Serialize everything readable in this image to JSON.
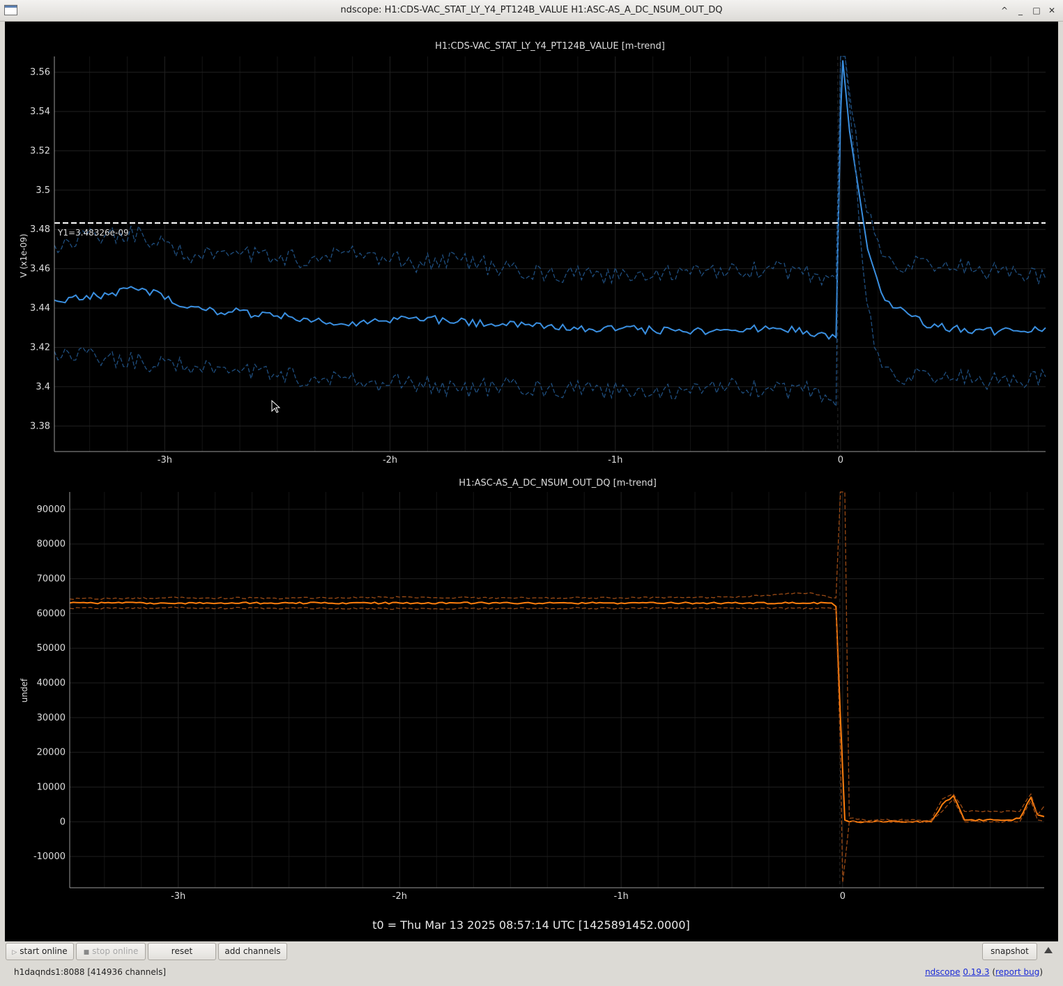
{
  "window": {
    "title": "ndscope: H1:CDS-VAC_STAT_LY_Y4_PT124B_VALUE H1:ASC-AS_A_DC_NSUM_OUT_DQ",
    "controls": [
      "^",
      "_",
      "□",
      "✕"
    ]
  },
  "toolbar": {
    "start_online": "start online",
    "stop_online": "stop online",
    "reset": "reset",
    "add_channels": "add channels",
    "snapshot": "snapshot"
  },
  "status": {
    "server": "h1daqnds1:8088  [414936 channels]",
    "ndscope_link": "ndscope",
    "version_link": "0.19.3",
    "report_bug_link": "report bug"
  },
  "t0_label": "t0 = Thu Mar 13 2025 08:57:14 UTC [1425891452.0000]",
  "colors": {
    "plot_bg": "#000000",
    "grid": "#1f1f1f",
    "text": "#dddddd",
    "series_top": "#3a8fe0",
    "series_top_minmax": "#1f4f80",
    "series_bottom": "#ff7f0e",
    "series_bottom_minmax": "#9a4a15",
    "cursor": "#ffffff"
  },
  "chart_data": [
    {
      "type": "line",
      "title": "H1:CDS-VAC_STAT_LY_Y4_PT124B_VALUE [m-trend]",
      "xlabel": "",
      "ylabel": "V (x1e-09)",
      "x_unit": "hours relative to t0",
      "xlim": [
        -3.49,
        0.91
      ],
      "ylim": [
        3.367,
        3.568
      ],
      "x_tick_values": [
        -3,
        -2,
        -1,
        0
      ],
      "x_tick_labels": [
        "-3h",
        "-2h",
        "-1h",
        "0"
      ],
      "y_ticks": [
        3.38,
        3.4,
        3.42,
        3.44,
        3.46,
        3.48,
        3.5,
        3.52,
        3.54,
        3.56
      ],
      "y_tick_labels": [
        "3.38",
        "3.4",
        "3.42",
        "3.44",
        "3.46",
        "3.48",
        "3.5",
        "3.52",
        "3.54",
        "3.56"
      ],
      "grid": true,
      "cursor": {
        "value": 3.48326,
        "label": "Y1=3.48326e-09"
      },
      "series": [
        {
          "role": "mean",
          "style": "solid",
          "x": [
            -3.49,
            -3.3,
            -3.1,
            -2.9,
            -2.7,
            -2.5,
            -2.3,
            -2.1,
            -1.9,
            -1.7,
            -1.5,
            -1.3,
            -1.1,
            -0.9,
            -0.7,
            -0.5,
            -0.3,
            -0.1,
            -0.02,
            0.0,
            0.01,
            0.04,
            0.08,
            0.12,
            0.18,
            0.25,
            0.3,
            0.4,
            0.5,
            0.6,
            0.7,
            0.8,
            0.91
          ],
          "y": [
            3.444,
            3.446,
            3.45,
            3.44,
            3.438,
            3.436,
            3.433,
            3.432,
            3.435,
            3.433,
            3.432,
            3.431,
            3.429,
            3.429,
            3.428,
            3.429,
            3.43,
            3.427,
            3.425,
            3.538,
            3.566,
            3.53,
            3.5,
            3.47,
            3.448,
            3.44,
            3.437,
            3.43,
            3.43,
            3.429,
            3.428,
            3.428,
            3.43
          ]
        },
        {
          "role": "max",
          "style": "dashed",
          "x": [
            -3.49,
            -3.3,
            -3.1,
            -2.9,
            -2.7,
            -2.5,
            -2.3,
            -2.1,
            -1.9,
            -1.7,
            -1.5,
            -1.3,
            -1.1,
            -0.9,
            -0.7,
            -0.5,
            -0.3,
            -0.1,
            -0.02,
            0.0,
            0.02,
            0.05,
            0.1,
            0.15,
            0.2,
            0.3,
            0.4,
            0.5,
            0.6,
            0.7,
            0.8,
            0.91
          ],
          "y": [
            3.472,
            3.476,
            3.478,
            3.466,
            3.468,
            3.464,
            3.466,
            3.468,
            3.462,
            3.465,
            3.46,
            3.458,
            3.456,
            3.458,
            3.459,
            3.458,
            3.46,
            3.457,
            3.455,
            3.568,
            3.568,
            3.54,
            3.5,
            3.478,
            3.466,
            3.462,
            3.462,
            3.46,
            3.459,
            3.458,
            3.457,
            3.455
          ]
        },
        {
          "role": "min",
          "style": "dashed",
          "x": [
            -3.49,
            -3.3,
            -3.1,
            -2.9,
            -2.7,
            -2.5,
            -2.3,
            -2.1,
            -1.9,
            -1.7,
            -1.5,
            -1.3,
            -1.1,
            -0.9,
            -0.7,
            -0.5,
            -0.3,
            -0.1,
            -0.02,
            0.0,
            0.02,
            0.05,
            0.1,
            0.15,
            0.2,
            0.3,
            0.4,
            0.5,
            0.6,
            0.7,
            0.8,
            0.91
          ],
          "y": [
            3.418,
            3.414,
            3.413,
            3.41,
            3.408,
            3.405,
            3.404,
            3.402,
            3.402,
            3.398,
            3.401,
            3.399,
            3.398,
            3.399,
            3.398,
            3.4,
            3.398,
            3.399,
            3.39,
            3.568,
            3.568,
            3.53,
            3.46,
            3.42,
            3.41,
            3.405,
            3.405,
            3.404,
            3.403,
            3.402,
            3.402,
            3.405
          ]
        }
      ]
    },
    {
      "type": "line",
      "title": "H1:ASC-AS_A_DC_NSUM_OUT_DQ [m-trend]",
      "xlabel": "",
      "ylabel": "undef",
      "x_unit": "hours relative to t0",
      "xlim": [
        -3.49,
        0.91
      ],
      "ylim": [
        -19000,
        95000
      ],
      "x_tick_values": [
        -3,
        -2,
        -1,
        0
      ],
      "x_tick_labels": [
        "-3h",
        "-2h",
        "-1h",
        "0"
      ],
      "y_ticks": [
        -10000,
        0,
        10000,
        20000,
        30000,
        40000,
        50000,
        60000,
        70000,
        80000,
        90000
      ],
      "y_tick_labels": [
        "-10000",
        "0",
        "10000",
        "20000",
        "30000",
        "40000",
        "50000",
        "60000",
        "70000",
        "80000",
        "90000"
      ],
      "grid": true,
      "series": [
        {
          "role": "mean",
          "style": "solid",
          "x": [
            -3.49,
            -3.0,
            -2.5,
            -2.0,
            -1.5,
            -1.0,
            -0.5,
            -0.05,
            -0.03,
            -0.01,
            0.01,
            0.03,
            0.1,
            0.2,
            0.3,
            0.4,
            0.45,
            0.5,
            0.55,
            0.7,
            0.75,
            0.8,
            0.85,
            0.88,
            0.91
          ],
          "y": [
            63000,
            63000,
            63000,
            63000,
            63000,
            63000,
            63000,
            63000,
            62000,
            30000,
            500,
            0,
            0,
            0,
            0,
            0,
            5000,
            7500,
            500,
            500,
            500,
            1000,
            7000,
            2000,
            1500
          ]
        },
        {
          "role": "max",
          "style": "dashed",
          "x": [
            -3.49,
            -3.0,
            -2.5,
            -2.0,
            -1.5,
            -1.0,
            -0.5,
            -0.15,
            -0.05,
            -0.03,
            -0.01,
            0.01,
            0.03,
            0.1,
            0.3,
            0.4,
            0.45,
            0.5,
            0.55,
            0.7,
            0.8,
            0.85,
            0.88,
            0.91
          ],
          "y": [
            64200,
            64500,
            64400,
            64700,
            64500,
            64500,
            64700,
            66000,
            64500,
            64500,
            95000,
            95000,
            1000,
            500,
            500,
            500,
            6500,
            8000,
            3000,
            3000,
            3000,
            8000,
            2000,
            4500
          ]
        },
        {
          "role": "min",
          "style": "dashed",
          "x": [
            -3.49,
            -3.0,
            -2.5,
            -2.0,
            -1.5,
            -1.0,
            -0.5,
            -0.05,
            -0.03,
            -0.01,
            0.0,
            0.01,
            0.03,
            0.1,
            0.3,
            0.4,
            0.45,
            0.5,
            0.55,
            0.7,
            0.8,
            0.85,
            0.88,
            0.91
          ],
          "y": [
            61500,
            61600,
            61500,
            61400,
            61500,
            61500,
            61500,
            61500,
            61000,
            20000,
            -17500,
            -12000,
            0,
            0,
            0,
            0,
            3000,
            6500,
            0,
            0,
            0,
            6000,
            500,
            200
          ]
        }
      ]
    }
  ]
}
